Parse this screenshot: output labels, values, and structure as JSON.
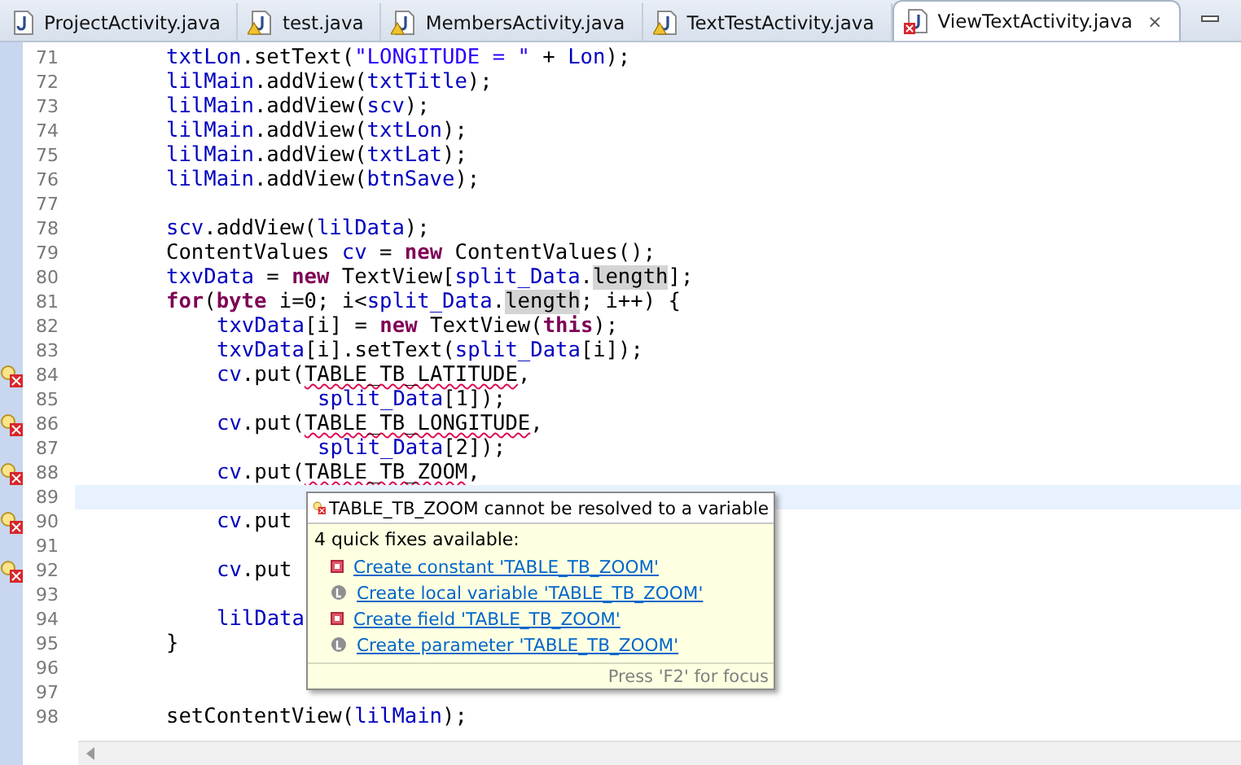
{
  "tabs": [
    {
      "label": "ProjectActivity.java",
      "warning": false,
      "error": false,
      "selected": false
    },
    {
      "label": "test.java",
      "warning": true,
      "error": false,
      "selected": false
    },
    {
      "label": "MembersActivity.java",
      "warning": true,
      "error": false,
      "selected": false
    },
    {
      "label": "TextTestActivity.java",
      "warning": true,
      "error": false,
      "selected": false
    },
    {
      "label": "ViewTextActivity.java",
      "warning": false,
      "error": true,
      "selected": true
    }
  ],
  "close_glyph": "⨯",
  "editor": {
    "lines": [
      {
        "number": "71",
        "kind": "statement",
        "error": false,
        "current": false,
        "tokens": [
          {
            "text": "txtLon",
            "kind": "field"
          },
          {
            "text": ".setText(",
            "kind": "plain"
          },
          {
            "text": "\"LONGITUDE = \"",
            "kind": "string"
          },
          {
            "text": " + ",
            "kind": "plain"
          },
          {
            "text": "Lon",
            "kind": "field"
          },
          {
            "text": ");",
            "kind": "plain"
          }
        ]
      },
      {
        "number": "72",
        "kind": "statement",
        "error": false,
        "current": false,
        "tokens": [
          {
            "text": "lilMain",
            "kind": "field"
          },
          {
            "text": ".addView(",
            "kind": "plain"
          },
          {
            "text": "txtTitle",
            "kind": "field"
          },
          {
            "text": ");",
            "kind": "plain"
          }
        ]
      },
      {
        "number": "73",
        "kind": "statement",
        "error": false,
        "current": false,
        "tokens": [
          {
            "text": "lilMain",
            "kind": "field"
          },
          {
            "text": ".addView(",
            "kind": "plain"
          },
          {
            "text": "scv",
            "kind": "field"
          },
          {
            "text": ");",
            "kind": "plain"
          }
        ]
      },
      {
        "number": "74",
        "kind": "statement",
        "error": false,
        "current": false,
        "tokens": [
          {
            "text": "lilMain",
            "kind": "field"
          },
          {
            "text": ".addView(",
            "kind": "plain"
          },
          {
            "text": "txtLon",
            "kind": "field"
          },
          {
            "text": ");",
            "kind": "plain"
          }
        ]
      },
      {
        "number": "75",
        "kind": "statement",
        "error": false,
        "current": false,
        "tokens": [
          {
            "text": "lilMain",
            "kind": "field"
          },
          {
            "text": ".addView(",
            "kind": "plain"
          },
          {
            "text": "txtLat",
            "kind": "field"
          },
          {
            "text": ");",
            "kind": "plain"
          }
        ]
      },
      {
        "number": "76",
        "kind": "statement",
        "error": false,
        "current": false,
        "tokens": [
          {
            "text": "lilMain",
            "kind": "field"
          },
          {
            "text": ".addView(",
            "kind": "plain"
          },
          {
            "text": "btnSave",
            "kind": "field"
          },
          {
            "text": ");",
            "kind": "plain"
          }
        ]
      },
      {
        "number": "77",
        "error": false,
        "current": false
      },
      {
        "number": "78",
        "kind": "statement",
        "error": false,
        "current": false,
        "tokens": [
          {
            "text": "scv",
            "kind": "field"
          },
          {
            "text": ".addView(",
            "kind": "plain"
          },
          {
            "text": "lilData",
            "kind": "field"
          },
          {
            "text": ");",
            "kind": "plain"
          }
        ]
      },
      {
        "number": "79",
        "kind": "statement",
        "error": false,
        "current": false,
        "tokens": [
          {
            "text": "ContentValues ",
            "kind": "plain"
          },
          {
            "text": "cv",
            "kind": "field"
          },
          {
            "text": " = ",
            "kind": "plain"
          },
          {
            "text": "new",
            "kind": "keyword"
          },
          {
            "text": " ContentValues();",
            "kind": "plain"
          }
        ]
      },
      {
        "number": "80",
        "kind": "statement",
        "error": false,
        "current": false,
        "tokens": [
          {
            "text": "txvData",
            "kind": "field"
          },
          {
            "text": " = ",
            "kind": "plain"
          },
          {
            "text": "new",
            "kind": "keyword"
          },
          {
            "text": " TextView[",
            "kind": "plain"
          },
          {
            "text": "split_Data",
            "kind": "field"
          },
          {
            "text": ".",
            "kind": "plain"
          },
          {
            "text": "length",
            "kind": "occurrence"
          },
          {
            "text": "];",
            "kind": "plain"
          }
        ]
      },
      {
        "number": "81",
        "kind": "statement",
        "error": false,
        "current": false,
        "tokens": [
          {
            "text": "for",
            "kind": "keyword"
          },
          {
            "text": "(",
            "kind": "plain"
          },
          {
            "text": "byte",
            "kind": "keyword"
          },
          {
            "text": " i=0; i<",
            "kind": "plain"
          },
          {
            "text": "split_Data",
            "kind": "field"
          },
          {
            "text": ".",
            "kind": "plain"
          },
          {
            "text": "length",
            "kind": "occurrence"
          },
          {
            "text": "; i++) {",
            "kind": "plain"
          }
        ]
      },
      {
        "number": "82",
        "kind": "nested",
        "error": false,
        "current": false,
        "tokens": [
          {
            "text": "txvData",
            "kind": "field"
          },
          {
            "text": "[i] = ",
            "kind": "plain"
          },
          {
            "text": "new",
            "kind": "keyword"
          },
          {
            "text": " TextView(",
            "kind": "plain"
          },
          {
            "text": "this",
            "kind": "keyword"
          },
          {
            "text": ");",
            "kind": "plain"
          }
        ]
      },
      {
        "number": "83",
        "kind": "nested",
        "error": false,
        "current": false,
        "tokens": [
          {
            "text": "txvData",
            "kind": "field"
          },
          {
            "text": "[i].setText(",
            "kind": "plain"
          },
          {
            "text": "split_Data",
            "kind": "field"
          },
          {
            "text": "[i]);",
            "kind": "plain"
          }
        ]
      },
      {
        "number": "84",
        "kind": "nested",
        "error": true,
        "current": false,
        "tokens": [
          {
            "text": "cv",
            "kind": "field"
          },
          {
            "text": ".put(",
            "kind": "plain"
          },
          {
            "text": "TABLE_TB_LATITUDE",
            "kind": "error"
          },
          {
            "text": ",",
            "kind": "plain"
          }
        ]
      },
      {
        "number": "85",
        "kind": "continuation",
        "error": false,
        "current": false,
        "tokens": [
          {
            "text": "split_Data",
            "kind": "field"
          },
          {
            "text": "[1]);",
            "kind": "plain"
          }
        ]
      },
      {
        "number": "86",
        "kind": "nested",
        "error": true,
        "current": false,
        "tokens": [
          {
            "text": "cv",
            "kind": "field"
          },
          {
            "text": ".put(",
            "kind": "plain"
          },
          {
            "text": "TABLE_TB_LONGITUDE",
            "kind": "error"
          },
          {
            "text": ",",
            "kind": "plain"
          }
        ]
      },
      {
        "number": "87",
        "kind": "continuation",
        "error": false,
        "current": false,
        "tokens": [
          {
            "text": "split_Data",
            "kind": "field"
          },
          {
            "text": "[2]);",
            "kind": "plain"
          }
        ]
      },
      {
        "number": "88",
        "kind": "nested",
        "error": true,
        "current": false,
        "tokens": [
          {
            "text": "cv",
            "kind": "field"
          },
          {
            "text": ".put(",
            "kind": "plain"
          },
          {
            "text": "TABLE_TB_ZOOM",
            "kind": "error"
          },
          {
            "text": ",",
            "kind": "plain"
          }
        ]
      },
      {
        "number": "89",
        "error": false,
        "current": true
      },
      {
        "number": "90",
        "kind": "nested",
        "error": true,
        "current": false,
        "tokens": [
          {
            "text": "cv",
            "kind": "field"
          },
          {
            "text": ".put",
            "kind": "plain"
          }
        ]
      },
      {
        "number": "91",
        "error": false,
        "current": false
      },
      {
        "number": "92",
        "kind": "nested",
        "error": true,
        "current": false,
        "tokens": [
          {
            "text": "cv",
            "kind": "field"
          },
          {
            "text": ".put",
            "kind": "plain"
          }
        ]
      },
      {
        "number": "93",
        "error": false,
        "current": false
      },
      {
        "number": "94",
        "kind": "nested",
        "error": false,
        "current": false,
        "tokens": [
          {
            "text": "lilData",
            "kind": "field"
          }
        ]
      },
      {
        "number": "95",
        "kind": "statement",
        "error": false,
        "current": false,
        "tokens": [
          {
            "text": "}",
            "kind": "plain"
          }
        ]
      },
      {
        "number": "96",
        "error": false,
        "current": false
      },
      {
        "number": "97",
        "error": false,
        "current": false
      },
      {
        "number": "98",
        "kind": "statement",
        "error": false,
        "current": false,
        "tokens": [
          {
            "text": "setContentView(",
            "kind": "plain"
          },
          {
            "text": "lilMain",
            "kind": "field"
          },
          {
            "text": ");",
            "kind": "plain"
          }
        ]
      }
    ]
  },
  "popup": {
    "message": "TABLE_TB_ZOOM cannot be resolved to a variable",
    "summary": "4 quick fixes available:",
    "fixes": [
      {
        "label": "Create constant 'TABLE_TB_ZOOM'",
        "kind": "constant"
      },
      {
        "label": "Create local variable 'TABLE_TB_ZOOM'",
        "kind": "local"
      },
      {
        "label": "Create field 'TABLE_TB_ZOOM'",
        "kind": "constant"
      },
      {
        "label": "Create parameter 'TABLE_TB_ZOOM'",
        "kind": "local"
      }
    ],
    "footer": "Press 'F2' for focus"
  }
}
